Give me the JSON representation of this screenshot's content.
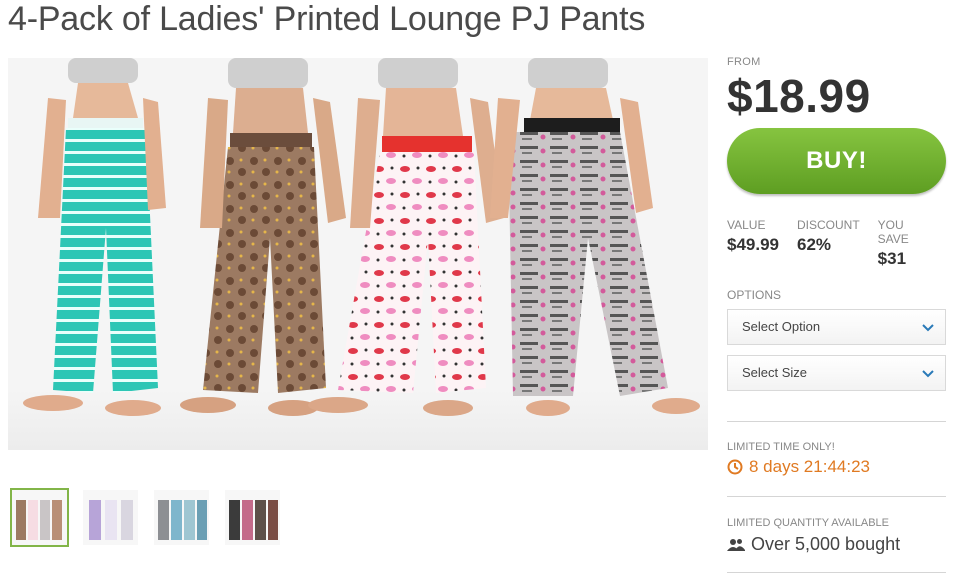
{
  "product": {
    "title": "4-Pack of Ladies' Printed Lounge PJ Pants"
  },
  "pricing": {
    "from_label": "FROM",
    "price": "$18.99",
    "buy_label": "BUY!",
    "value_label": "VALUE",
    "value": "$49.99",
    "discount_label": "DISCOUNT",
    "discount": "62%",
    "save_label": "YOU SAVE",
    "save": "$31"
  },
  "options": {
    "label": "OPTIONS",
    "option_select": "Select Option",
    "size_select": "Select Size"
  },
  "deal": {
    "limited_label": "LIMITED TIME ONLY!",
    "timer": "8 days 21:44:23",
    "quantity_label": "LIMITED QUANTITY AVAILABLE",
    "bought": "Over 5,000 bought"
  },
  "colors": {
    "accent_green": "#6aad2c",
    "timer_orange": "#e07a22"
  }
}
